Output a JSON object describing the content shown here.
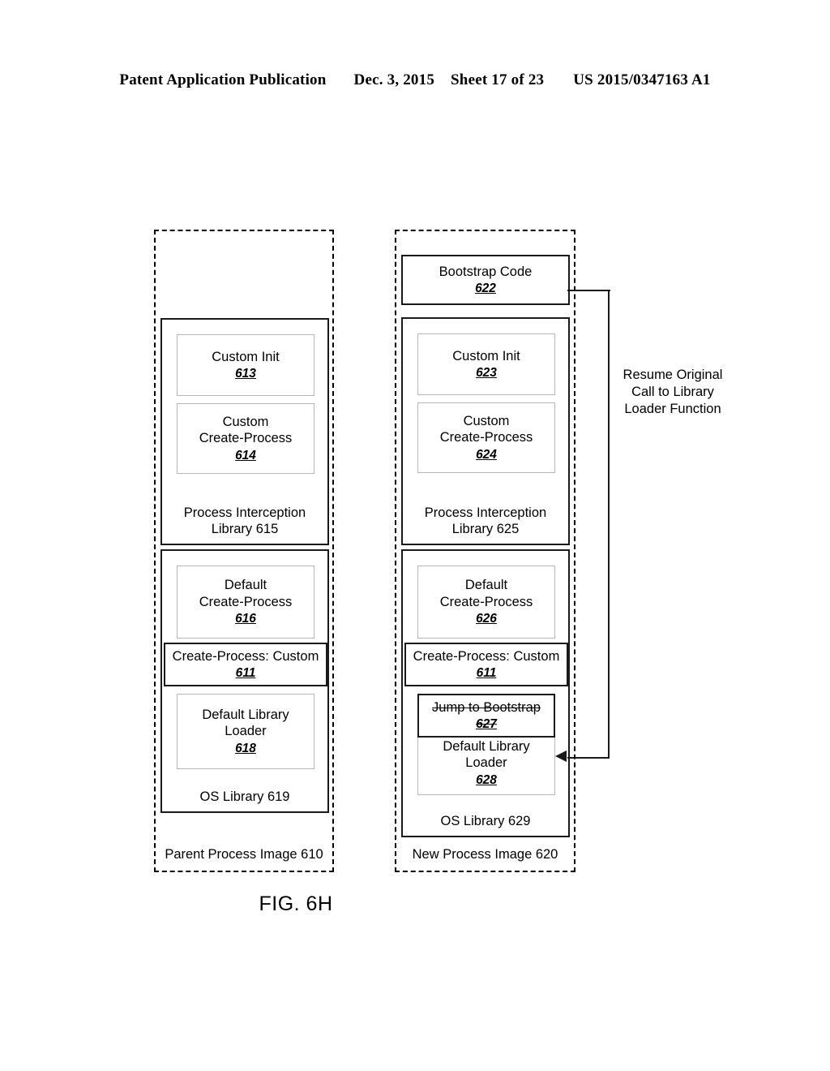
{
  "header": {
    "publication": "Patent Application Publication",
    "date": "Dec. 3, 2015",
    "sheet": "Sheet 17 of 23",
    "patent_number": "US 2015/0347163 A1"
  },
  "figure": {
    "caption": "FIG. 6H",
    "callout": "Resume Original Call to Library Loader Function"
  },
  "parent_image": {
    "caption": "Parent Process Image 610",
    "interception_library": {
      "caption_line1": "Process Interception",
      "caption_line2": "Library 615",
      "components": [
        {
          "label": "Custom Init",
          "ref": "613"
        },
        {
          "label": "Custom\nCreate-Process",
          "ref": "614"
        }
      ]
    },
    "os_library": {
      "caption": "OS Library 619",
      "components": [
        {
          "label": "Default\nCreate-Process",
          "ref": "616"
        },
        {
          "label": "Create-Process: Custom",
          "ref": "611"
        },
        {
          "label": "Default Library\nLoader",
          "ref": "618"
        }
      ]
    }
  },
  "new_image": {
    "caption": "New Process Image 620",
    "bootstrap": {
      "label": "Bootstrap Code",
      "ref": "622"
    },
    "interception_library": {
      "caption_line1": "Process Interception",
      "caption_line2": "Library 625",
      "components": [
        {
          "label": "Custom Init",
          "ref": "623"
        },
        {
          "label": "Custom\nCreate-Process",
          "ref": "624"
        }
      ]
    },
    "os_library": {
      "caption": "OS Library 629",
      "components": [
        {
          "label": "Default\nCreate-Process",
          "ref": "626"
        },
        {
          "label": "Create-Process: Custom",
          "ref": "611"
        },
        {
          "label": "Jump to Bootstrap",
          "ref": "627"
        },
        {
          "label": "Default Library\nLoader",
          "ref": "628"
        }
      ]
    }
  }
}
